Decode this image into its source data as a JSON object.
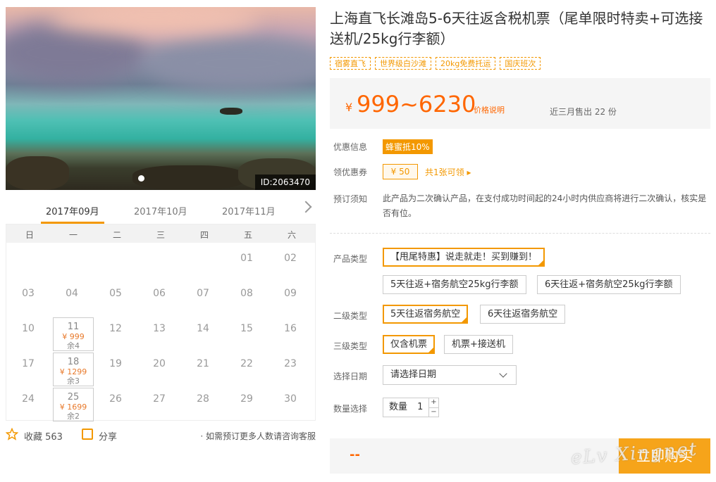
{
  "product": {
    "title": "上海直飞长滩岛5-6天往返含税机票（尾单限时特卖+可选接送机/25kg行李额）",
    "image_id": "ID:2063470",
    "tags": [
      "宿雾直飞",
      "世界级白沙滩",
      "20kg免费托运",
      "国庆班次"
    ]
  },
  "calendar": {
    "months": [
      "2017年09月",
      "2017年10月",
      "2017年11月"
    ],
    "active_month": "2017年09月",
    "weekdays": [
      "日",
      "一",
      "二",
      "三",
      "四",
      "五",
      "六"
    ],
    "weeks": [
      [
        "",
        "",
        "",
        "",
        "",
        "01",
        "02"
      ],
      [
        "03",
        "04",
        "05",
        "06",
        "07",
        "08",
        "09"
      ],
      [
        "10",
        "11",
        "12",
        "13",
        "14",
        "15",
        "16"
      ],
      [
        "17",
        "18",
        "19",
        "20",
        "21",
        "22",
        "23"
      ],
      [
        "24",
        "25",
        "26",
        "27",
        "28",
        "29",
        "30"
      ]
    ],
    "available": [
      {
        "day": "11",
        "price": "¥ 999",
        "remain": "余4"
      },
      {
        "day": "18",
        "price": "¥ 1299",
        "remain": "余3"
      },
      {
        "day": "25",
        "price": "¥ 1699",
        "remain": "余2"
      }
    ]
  },
  "actions": {
    "favorite_label": "收藏 563",
    "share_label": "分享",
    "contact_note": "· 如需预订更多人数请咨询客服"
  },
  "price": {
    "currency": "¥",
    "range": "999~6230",
    "explain_label": "价格说明",
    "sold_label": "近三月售出 22 份"
  },
  "info": {
    "discount_label": "优惠信息",
    "discount_badge": "蜂蜜抵10%",
    "coupon_label": "领优惠券",
    "coupon_value": "¥ 50",
    "coupon_more": "共1张可领 ▸",
    "notice_label": "预订须知",
    "notice_text": "此产品为二次确认产品，在支付成功时间起的24小时内供应商将进行二次确认，核实是否有位。"
  },
  "options": {
    "product_type_label": "产品类型",
    "product_types": [
      "【甩尾特惠】说走就走！买到赚到！",
      "5天往返+宿务航空25kg行李额",
      "6天往返+宿务航空25kg行李额"
    ],
    "level2_label": "二级类型",
    "level2_types": [
      "5天往返宿务航空",
      "6天往返宿务航空"
    ],
    "level3_label": "三级类型",
    "level3_types": [
      "仅含机票",
      "机票+接送机"
    ],
    "date_label": "选择日期",
    "date_placeholder": "请选择日期",
    "qty_label": "数量选择",
    "qty_text": "数量",
    "qty_value": "1",
    "qty_plus": "+",
    "qty_minus": "−"
  },
  "buy": {
    "price_placeholder": "--",
    "button_label": "立即购买"
  },
  "watermark": "eLv Xingnet",
  "colors": {
    "accent": "#f39800",
    "price": "#ff6600"
  }
}
